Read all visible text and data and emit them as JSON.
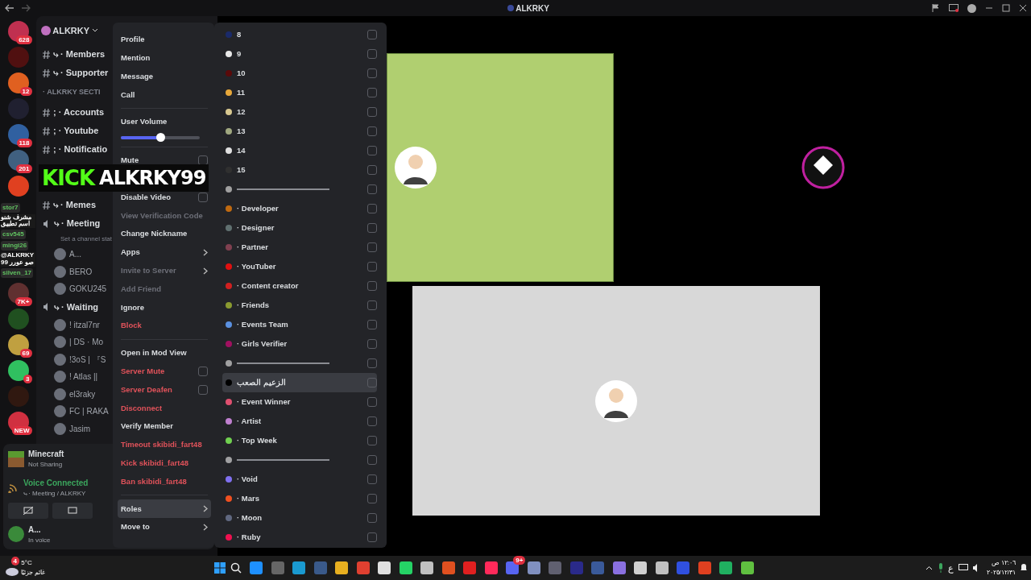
{
  "window": {
    "title": "ALKRKY"
  },
  "servers": [
    {
      "badge": "628",
      "color": "#c03050"
    },
    {
      "color": "#501010"
    },
    {
      "badge": "12",
      "color": "#e06020"
    },
    {
      "color": "#202030"
    },
    {
      "badge": "118",
      "color": "#3060a0"
    },
    {
      "badge": "201",
      "color": "#406080"
    },
    {
      "color": "#e04020"
    },
    {
      "badge": "7K+",
      "color": "#603030"
    },
    {
      "color": "#205020"
    },
    {
      "badge": "69",
      "color": "#c0a040"
    },
    {
      "badge": "3",
      "color": "#30c060"
    },
    {
      "color": "#301810"
    },
    {
      "badge": "NEW",
      "color": "#d03040"
    }
  ],
  "server_name": "ALKRKY",
  "channels": [
    {
      "kind": "text",
      "name": "⤷ · Members"
    },
    {
      "kind": "text",
      "name": "⤷ · Supporter"
    },
    {
      "kind": "category",
      "name": "· ALKRKY SECTI"
    },
    {
      "kind": "text",
      "name": "; · Accounts"
    },
    {
      "kind": "text",
      "name": "; · Youtube"
    },
    {
      "kind": "text",
      "name": "; · Notificatio"
    },
    {
      "kind": "text",
      "name": "⤷ · Memes"
    },
    {
      "kind": "voice",
      "name": "⤷ · Meeting"
    },
    {
      "kind": "status",
      "name": "Set a channel stat"
    },
    {
      "kind": "user",
      "name": "A..."
    },
    {
      "kind": "user",
      "name": "BERO"
    },
    {
      "kind": "user",
      "name": "GOKU245"
    },
    {
      "kind": "voice",
      "name": "⤷ · Waiting"
    },
    {
      "kind": "user",
      "name": "! itzal7nr"
    },
    {
      "kind": "user",
      "name": "| DS · Mo"
    },
    {
      "kind": "user",
      "name": "!3ᴏS | 『S"
    },
    {
      "kind": "user",
      "name": "! Atlas ||"
    },
    {
      "kind": "user",
      "name": "el3raky"
    },
    {
      "kind": "user",
      "name": "FC | RAKA"
    },
    {
      "kind": "user",
      "name": "Jasim"
    }
  ],
  "activity": {
    "title": "Minecraft",
    "subtitle": "Not Sharing"
  },
  "voice": {
    "status": "Voice Connected",
    "channel": "⤷ · Meeting / ALKRKY"
  },
  "user": {
    "name": "A...",
    "status": "In voice"
  },
  "overlay_banner": {
    "brand": "KICK",
    "name": "ALKRKY99"
  },
  "stream_chat": [
    {
      "user": "stor7",
      "message": "مشرف شنو اسم تطبيق"
    },
    {
      "user": "csv545"
    },
    {
      "user": "mingi26",
      "message": "@ALKRKY99 صو عورر"
    },
    {
      "user": "silven_17"
    }
  ],
  "context_menu": [
    {
      "kind": "item",
      "label": "Profile",
      "danger": false,
      "disabled": false
    },
    {
      "kind": "item",
      "label": "Mention",
      "danger": false,
      "disabled": false
    },
    {
      "kind": "item",
      "label": "Message",
      "danger": false,
      "disabled": false
    },
    {
      "kind": "item",
      "label": "Call",
      "danger": false,
      "disabled": false
    },
    {
      "kind": "separator"
    },
    {
      "kind": "slider",
      "label": "User Volume",
      "level": 0.5
    },
    {
      "kind": "separator"
    },
    {
      "kind": "check",
      "label": "Mute",
      "danger": false,
      "checked": false
    },
    {
      "kind": "hidden"
    },
    {
      "kind": "check",
      "label": "Disable Video",
      "danger": false,
      "checked": false
    },
    {
      "kind": "item",
      "label": "View Verification Code",
      "danger": false,
      "disabled": true
    },
    {
      "kind": "item",
      "label": "Change Nickname",
      "danger": false,
      "disabled": false
    },
    {
      "kind": "submenu",
      "label": "Apps",
      "disabled": false,
      "hovered": false
    },
    {
      "kind": "submenu",
      "label": "Invite to Server",
      "disabled": true,
      "hovered": false
    },
    {
      "kind": "item",
      "label": "Add Friend",
      "danger": false,
      "disabled": true
    },
    {
      "kind": "item",
      "label": "Ignore",
      "danger": false,
      "disabled": false
    },
    {
      "kind": "item",
      "label": "Block",
      "danger": true,
      "disabled": false
    },
    {
      "kind": "separator"
    },
    {
      "kind": "item",
      "label": "Open in Mod View",
      "danger": false,
      "disabled": false
    },
    {
      "kind": "check",
      "label": "Server Mute",
      "danger": true,
      "checked": false
    },
    {
      "kind": "check",
      "label": "Server Deafen",
      "danger": true,
      "checked": false
    },
    {
      "kind": "item",
      "label": "Disconnect",
      "danger": true,
      "disabled": false
    },
    {
      "kind": "item",
      "label": "Verify Member",
      "danger": false,
      "disabled": false
    },
    {
      "kind": "item",
      "label": "Timeout skibidi_fart48",
      "danger": true,
      "disabled": false
    },
    {
      "kind": "item",
      "label": "Kick skibidi_fart48",
      "danger": true,
      "disabled": false
    },
    {
      "kind": "item",
      "label": "Ban skibidi_fart48",
      "danger": true,
      "disabled": false
    },
    {
      "kind": "separator"
    },
    {
      "kind": "submenu",
      "label": "Roles",
      "disabled": false,
      "hovered": true
    },
    {
      "kind": "submenu",
      "label": "Move to",
      "disabled": false,
      "hovered": false
    }
  ],
  "roles": [
    {
      "kind": "role",
      "label": "8",
      "color": "#1a2a6a",
      "checked": false,
      "hovered": false
    },
    {
      "kind": "role",
      "label": "9",
      "color": "#e8e8e8",
      "checked": false,
      "hovered": false
    },
    {
      "kind": "role",
      "label": "10",
      "color": "#5a0a0a",
      "checked": false,
      "hovered": false
    },
    {
      "kind": "role",
      "label": "11",
      "color": "#e8a83a",
      "checked": false,
      "hovered": false
    },
    {
      "kind": "role",
      "label": "12",
      "color": "#d8c890",
      "checked": false,
      "hovered": false
    },
    {
      "kind": "role",
      "label": "13",
      "color": "#a0a880",
      "checked": false,
      "hovered": false
    },
    {
      "kind": "role",
      "label": "14",
      "color": "#e0e0e0",
      "checked": false,
      "hovered": false
    },
    {
      "kind": "role",
      "label": "15",
      "color": "#303030",
      "checked": false,
      "hovered": false
    },
    {
      "kind": "divider",
      "color": "#a0a0a0",
      "checked": false,
      "hovered": false
    },
    {
      "kind": "role",
      "label": "· Developer",
      "color": "#c06a10",
      "checked": false,
      "hovered": false
    },
    {
      "kind": "role",
      "label": "· Designer",
      "color": "#607070",
      "checked": false,
      "hovered": false
    },
    {
      "kind": "role",
      "label": "· Partner",
      "color": "#804050",
      "checked": false,
      "hovered": false
    },
    {
      "kind": "role",
      "label": "· YouTuber",
      "color": "#e01010",
      "checked": false,
      "hovered": false
    },
    {
      "kind": "role",
      "label": "· Content creator",
      "color": "#d02020",
      "checked": false,
      "hovered": false
    },
    {
      "kind": "role",
      "label": "· Friends",
      "color": "#8a9a30",
      "checked": false,
      "hovered": false
    },
    {
      "kind": "role",
      "label": "· Events Team",
      "color": "#5a90e0",
      "checked": false,
      "hovered": false
    },
    {
      "kind": "role",
      "label": "· Girls Verifier",
      "color": "#a01060",
      "checked": false,
      "hovered": false
    },
    {
      "kind": "divider",
      "color": "#a0a0a1",
      "checked": false,
      "hovered": false
    },
    {
      "kind": "role",
      "label": "الزعيم الصعب",
      "color": "#000000",
      "checked": false,
      "hovered": true
    },
    {
      "kind": "role",
      "label": "· Event Winner",
      "color": "#e05070",
      "checked": false,
      "hovered": false
    },
    {
      "kind": "role",
      "label": "· Artist",
      "color": "#c080d0",
      "checked": false,
      "hovered": false
    },
    {
      "kind": "role",
      "label": "· Top Week",
      "color": "#70d050",
      "checked": false,
      "hovered": false
    },
    {
      "kind": "divider",
      "color": "#a0a0a2",
      "checked": false,
      "hovered": false
    },
    {
      "kind": "role",
      "label": "· Void",
      "color": "#8070f0",
      "checked": false,
      "hovered": false
    },
    {
      "kind": "role",
      "label": "· Mars",
      "color": "#f05020",
      "checked": false,
      "hovered": false
    },
    {
      "kind": "role",
      "label": "· Moon",
      "color": "#606880",
      "checked": false,
      "hovered": false
    },
    {
      "kind": "role",
      "label": "· Ruby",
      "color": "#f01050",
      "checked": false,
      "hovered": false
    }
  ],
  "stage": [
    {
      "kind": "tile",
      "color": "#b0cf70"
    },
    {
      "kind": "avatar",
      "color": "#c020a0"
    },
    {
      "kind": "tile",
      "color": "#d8d8d8"
    }
  ],
  "taskbar": {
    "weather_temp": "5°C",
    "weather_text": "غائم جزئيًا",
    "weather_badge": "4",
    "discord_badge": "9+",
    "keyboard": "ع",
    "time": "١٢:٠٦ ص",
    "date": "٢٠٢٥/١٢/٣١",
    "apps": [
      {
        "color": "#1e90ff"
      },
      {
        "color": "#666666"
      },
      {
        "color": "#1a9ad0"
      },
      {
        "color": "#3a5a8a"
      },
      {
        "color": "#e8b020"
      },
      {
        "color": "#e04030"
      },
      {
        "color": "#e0e0e0"
      },
      {
        "color": "#25d366"
      },
      {
        "color": "#c0c0c0"
      },
      {
        "color": "#e05020"
      },
      {
        "color": "#e02020"
      },
      {
        "color": "#ff2a5a"
      },
      {
        "color": "#5865f2"
      },
      {
        "color": "#8090c0"
      },
      {
        "color": "#606070"
      },
      {
        "color": "#2a2a8a"
      },
      {
        "color": "#3a5a9a"
      },
      {
        "color": "#8a70e0"
      },
      {
        "color": "#d0d0d0"
      },
      {
        "color": "#c0c0c0"
      },
      {
        "color": "#3050e0"
      },
      {
        "color": "#e04020"
      },
      {
        "color": "#20b060"
      },
      {
        "color": "#60c040"
      }
    ]
  }
}
